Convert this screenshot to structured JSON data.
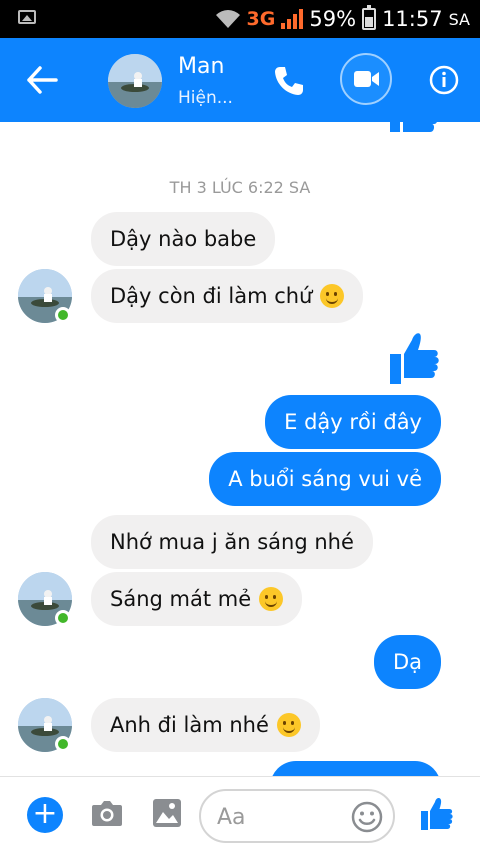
{
  "status_bar": {
    "network": "3G",
    "battery": "59%",
    "time": "11:57",
    "ampm": "SA"
  },
  "header": {
    "contact_name": "Man",
    "status": "Hiện..."
  },
  "chat": {
    "timestamp": "TH 3 LÚC 6:22 SA",
    "messages": [
      {
        "dir": "in",
        "text": "Dậy nào babe"
      },
      {
        "dir": "in",
        "text": "Dậy còn đi làm chứ",
        "emoji": "smile"
      },
      {
        "dir": "out",
        "sticker": "like"
      },
      {
        "dir": "out",
        "text": "E dậy rồi đây"
      },
      {
        "dir": "out",
        "text": "A buổi sáng vui vẻ"
      },
      {
        "dir": "in",
        "text": "Nhớ mua j ăn sáng nhé"
      },
      {
        "dir": "in",
        "text": "Sáng mát mẻ",
        "emoji": "kiss"
      },
      {
        "dir": "out",
        "text": "Dạ"
      },
      {
        "dir": "in",
        "text": "Anh đi làm nhé",
        "emoji": "wink-tongue"
      }
    ]
  },
  "composer": {
    "placeholder": "Aa"
  },
  "colors": {
    "brand": "#0d84fe",
    "incoming_bubble": "#f1f0f0",
    "online": "#42b72a"
  }
}
